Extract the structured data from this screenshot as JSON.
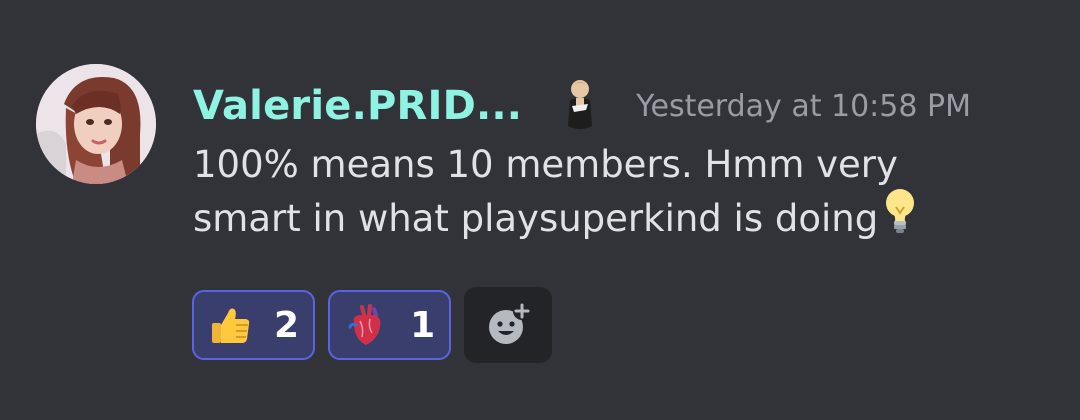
{
  "message": {
    "author": "Valerie.PRID...",
    "timestamp": "Yesterday at 10:58 PM",
    "lines": [
      "100% means 10 members. Hmm very",
      "smart in what playsuperkind is doing"
    ],
    "inline_emoji": "lightbulb-icon"
  },
  "reactions": [
    {
      "emoji": "thumbs-up-icon",
      "count": "2"
    },
    {
      "emoji": "anatomical-heart-icon",
      "count": "1"
    }
  ],
  "add_reaction": {
    "icon": "add-reaction-icon"
  },
  "colors": {
    "background": "#313338",
    "username": "#8ef3e3",
    "timestamp": "#9a9ca3",
    "text": "#e1e2e6",
    "reaction_border": "#5a64e0",
    "reaction_bg": "#3a3e6d"
  }
}
